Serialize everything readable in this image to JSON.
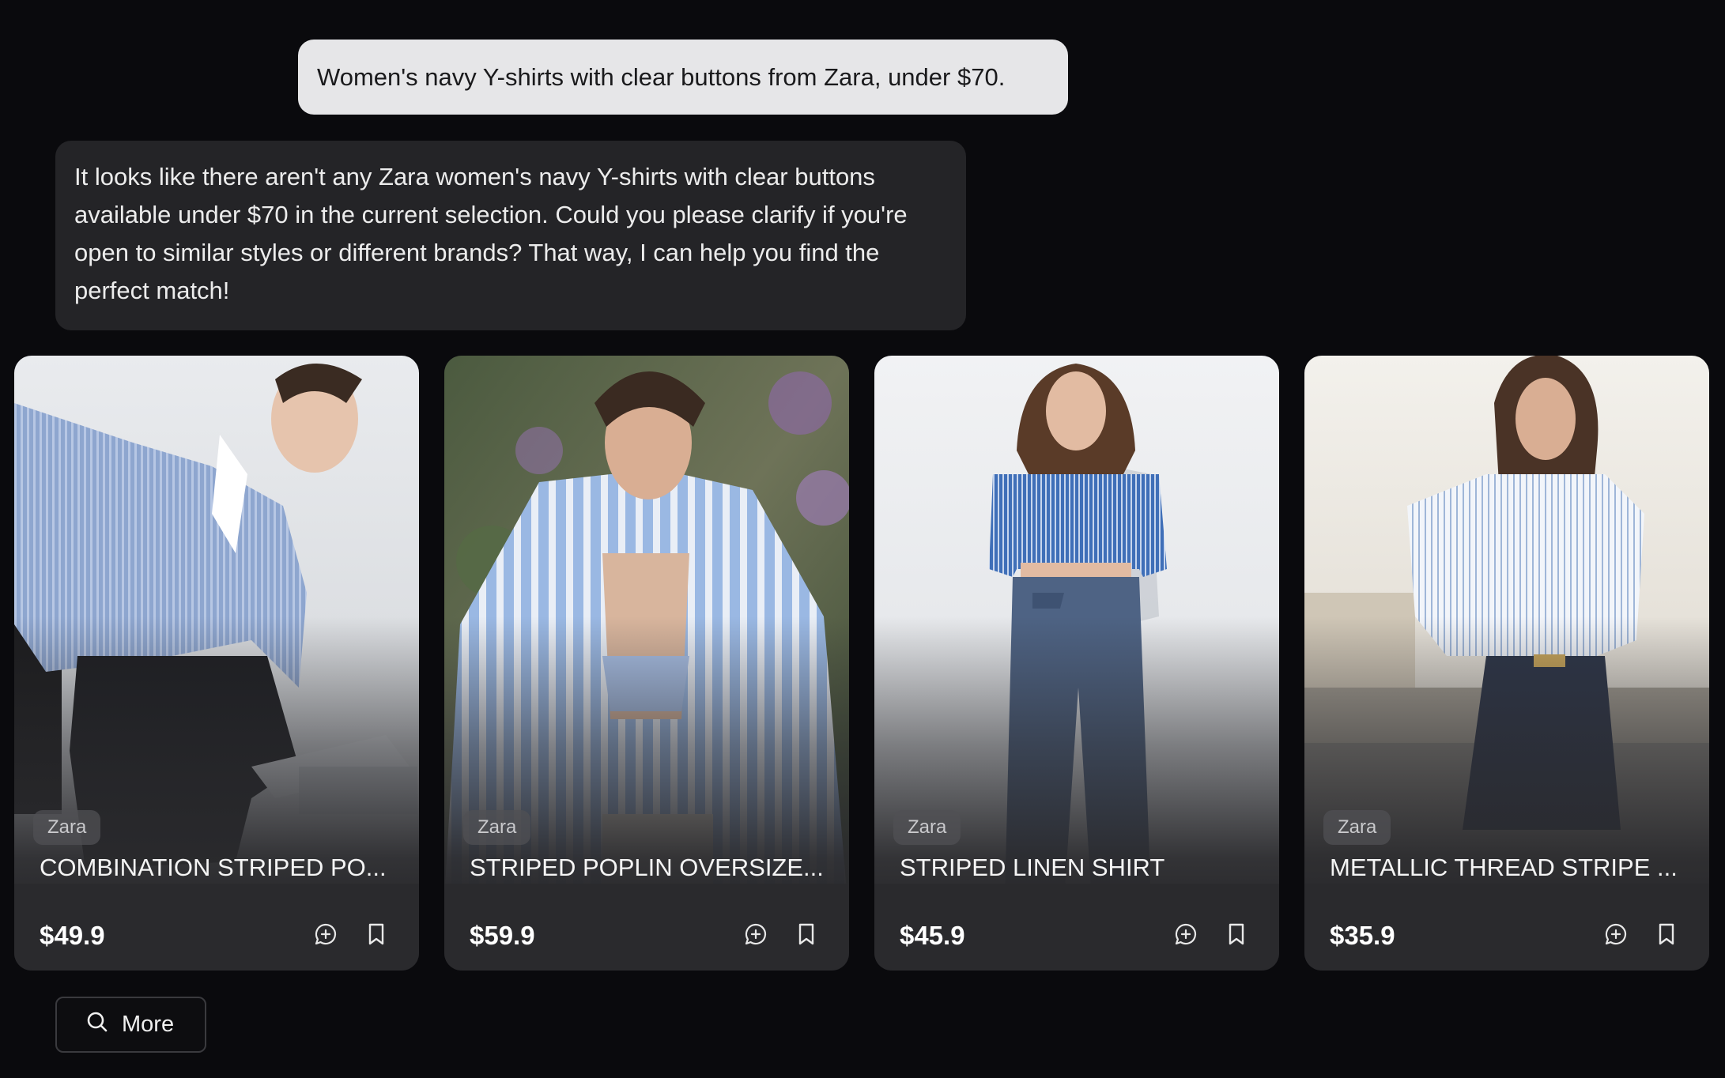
{
  "chat": {
    "user_message": "Women's navy Y-shirts with clear buttons from Zara, under $70.",
    "assistant_message": "It looks like there aren't any Zara women's navy Y-shirts with clear buttons available under $70 in the current selection. Could you please clarify if you're open to similar styles or different brands? That way, I can help you find the perfect match!"
  },
  "products": [
    {
      "brand": "Zara",
      "name": "COMBINATION STRIPED PO...",
      "price": "$49.9"
    },
    {
      "brand": "Zara",
      "name": "STRIPED POPLIN OVERSIZE...",
      "price": "$59.9"
    },
    {
      "brand": "Zara",
      "name": "STRIPED LINEN SHIRT",
      "price": "$45.9"
    },
    {
      "brand": "Zara",
      "name": "METALLIC THREAD STRIPE ...",
      "price": "$35.9"
    }
  ],
  "more_button": {
    "label": "More",
    "icon": "search-icon"
  },
  "card_icons": {
    "ask": "chat-plus-icon",
    "save": "bookmark-icon"
  },
  "colors": {
    "background": "#0a0a0d",
    "user_bubble": "#e6e6e8",
    "assistant_bubble": "#242427",
    "card": "#2a2a2d"
  }
}
